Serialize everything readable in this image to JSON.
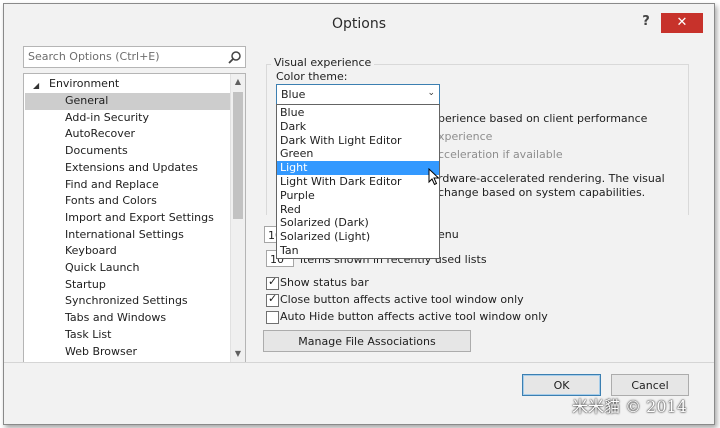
{
  "window": {
    "title": "Options",
    "help_label": "?",
    "close_label": "✕"
  },
  "search": {
    "placeholder": "Search Options (Ctrl+E)"
  },
  "tree": {
    "root_arrow": "◢",
    "root_label": "Environment",
    "items": [
      {
        "label": "General",
        "selected": true
      },
      {
        "label": "Add-in Security"
      },
      {
        "label": "AutoRecover"
      },
      {
        "label": "Documents"
      },
      {
        "label": "Extensions and Updates"
      },
      {
        "label": "Find and Replace"
      },
      {
        "label": "Fonts and Colors"
      },
      {
        "label": "Import and Export Settings"
      },
      {
        "label": "International Settings"
      },
      {
        "label": "Keyboard"
      },
      {
        "label": "Quick Launch"
      },
      {
        "label": "Startup"
      },
      {
        "label": "Synchronized Settings"
      },
      {
        "label": "Tabs and Windows"
      },
      {
        "label": "Task List"
      },
      {
        "label": "Web Browser"
      }
    ],
    "scroll_up": "▲",
    "scroll_down": "▼"
  },
  "visual_experience": {
    "group_label": "Visual experience",
    "color_theme_label": "Color theme:",
    "selected_theme": "Blue",
    "combo_arrow": "⌄",
    "options": [
      "Blue",
      "Dark",
      "Dark With Light Editor",
      "Green",
      "Light",
      "Light With Dark Editor",
      "Purple",
      "Red",
      "Solarized (Dark)",
      "Solarized (Light)",
      "Tan"
    ],
    "highlighted_option": "Light",
    "obscured_texts": {
      "perf": "perience based on client performance",
      "rich": "xperience",
      "hw": "cceleration if available",
      "note1": "rdware-accelerated rendering. The visual",
      "note2": "change based on system capabilities.",
      "menu": "enu"
    }
  },
  "recent": {
    "windows_count": "10",
    "files_count": "10",
    "files_label": "items shown in recently used lists"
  },
  "checkboxes": [
    {
      "label": "Show status bar",
      "checked": true
    },
    {
      "label": "Close button affects active tool window only",
      "checked": true
    },
    {
      "label": "Auto Hide button affects active tool window only",
      "checked": false
    }
  ],
  "check_mark": "✓",
  "manage_button": "Manage File Associations",
  "footer": {
    "ok_label": "OK",
    "cancel_label": "Cancel"
  },
  "watermark": "米米貓 © 2014"
}
